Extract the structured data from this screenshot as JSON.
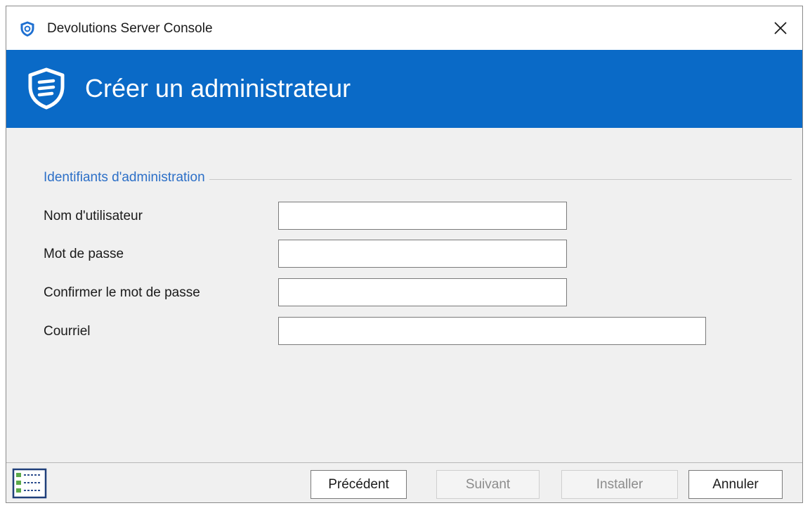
{
  "window": {
    "title": "Devolutions Server Console",
    "close_symbol": "✕"
  },
  "banner": {
    "title": "Créer un administrateur",
    "icon": "devolutions-shield-icon",
    "color": "#0a6ac7"
  },
  "section": {
    "header": "Identifiants d'administration"
  },
  "fields": {
    "username": {
      "label": "Nom d'utilisateur",
      "value": ""
    },
    "password": {
      "label": "Mot de passe",
      "value": ""
    },
    "confirm_password": {
      "label": "Confirmer le mot de passe",
      "value": ""
    },
    "email": {
      "label": "Courriel",
      "value": ""
    }
  },
  "buttons": {
    "previous": "Précédent",
    "next": "Suivant",
    "install": "Installer",
    "cancel": "Annuler"
  },
  "icons": {
    "app": "devolutions-shield-icon",
    "wizard": "checklist-icon",
    "close": "close-icon"
  }
}
